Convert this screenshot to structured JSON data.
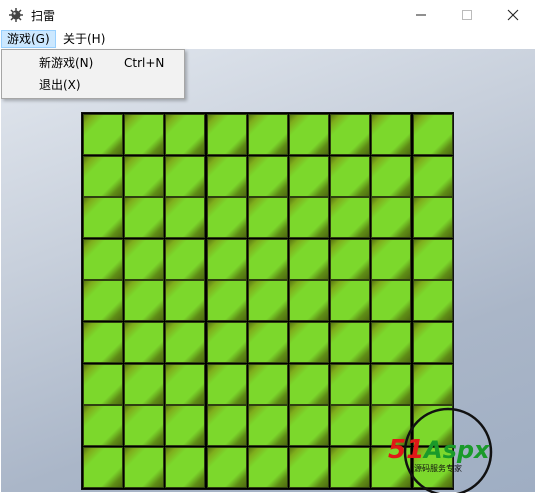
{
  "window": {
    "title": "扫雷"
  },
  "menubar": {
    "game": "游戏(G)",
    "about": "关于(H)"
  },
  "game_menu": {
    "items": [
      {
        "label": "新游戏(N)",
        "shortcut": "Ctrl+N"
      },
      {
        "label": "退出(X)",
        "shortcut": ""
      }
    ]
  },
  "board": {
    "cols": 9,
    "rows": 9,
    "cell_state": "covered"
  },
  "watermark": {
    "brand_red": "51",
    "brand_green": "Aspx",
    "tagline": "源码服务专家"
  },
  "colors": {
    "cell": "#7cd82c",
    "cell_dark": "#4e6b10",
    "menu_highlight": "#cce8ff"
  }
}
